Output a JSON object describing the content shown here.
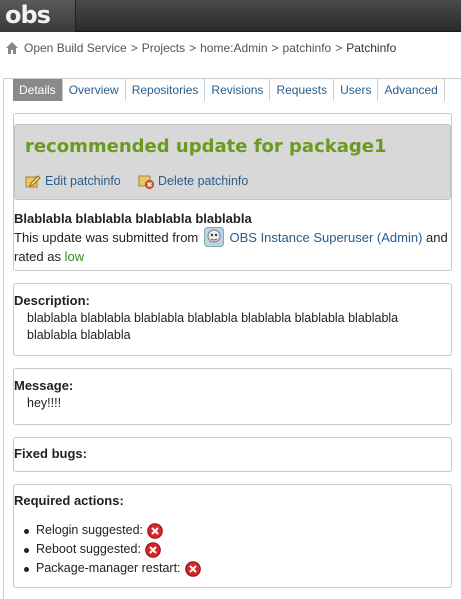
{
  "topbar": {
    "logo_text": "obs"
  },
  "breadcrumb": {
    "items": [
      "Open Build Service",
      "Projects",
      "home:Admin",
      "patchinfo"
    ],
    "separator": ">",
    "current": "Patchinfo"
  },
  "tabs": [
    "Details",
    "Overview",
    "Repositories",
    "Revisions",
    "Requests",
    "Users",
    "Advanced"
  ],
  "active_tab": "Details",
  "header": {
    "title": "recommended update for package1",
    "edit_label": "Edit patchinfo",
    "delete_label": "Delete patchinfo"
  },
  "summary": {
    "title": "Blablabla blablabla blablabla blablabla",
    "submitted_prefix": "This update was submitted from",
    "user": "OBS Instance Superuser (Admin)",
    "and": "and",
    "rated_prefix": "rated as",
    "rating": "low"
  },
  "description": {
    "label": "Description:",
    "line1": "blablabla blablabla blablabla blablabla blablabla blablabla blablabla",
    "line2": "blablabla blablabla"
  },
  "message": {
    "label": "Message:",
    "text": "hey!!!!"
  },
  "fixed_bugs": {
    "label": "Fixed bugs:"
  },
  "required_actions": {
    "label": "Required actions:",
    "items": [
      "Relogin suggested:",
      "Reboot suggested:",
      "Package-manager restart:"
    ]
  },
  "colors": {
    "title_green": "#6a9a1f",
    "link_blue": "#2a5d8a",
    "rating_green": "#3c8a1c",
    "error_red": "#d9262b"
  }
}
